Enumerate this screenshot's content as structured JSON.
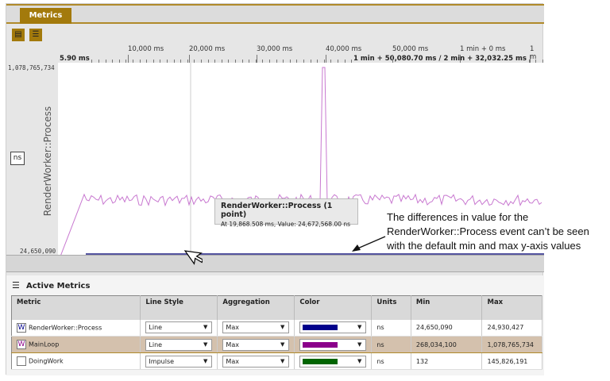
{
  "tab": {
    "label": "Metrics"
  },
  "toolbar": {
    "icons": [
      "clipboard-icon",
      "list-icon"
    ]
  },
  "ruler": {
    "ticks": [
      "10,000 ms",
      "20,000 ms",
      "30,000 ms",
      "40,000 ms",
      "50,000 ms",
      "1 min + 0 ms",
      "1 m"
    ],
    "start": "5.90 ms",
    "range": "1 min + 50,080.70 ms / 2 min + 32,032.25 ms"
  },
  "yaxis": {
    "max": "1,078,765,734",
    "min": "24,650,090",
    "title": "RenderWorker::Process",
    "unit": "ns"
  },
  "tooltip": {
    "title": "RenderWorker::Process (1 point)",
    "body": "At 19,868.508 ms, Value: 24,672,568.00 ns"
  },
  "annotation": "The differences in value for the RenderWorker::Process event can’t be seen with the default min and max y-axis values",
  "active_metrics": {
    "title": "Active Metrics",
    "columns": [
      "Metric",
      "Line Style",
      "Aggregation",
      "Color",
      "Units",
      "Min",
      "Max"
    ],
    "rows": [
      {
        "metric": "RenderWorker::Process",
        "line_style": "Line",
        "aggregation": "Max",
        "color": "#00008b",
        "units": "ns",
        "min": "24,650,090",
        "max": "24,930,427",
        "checked": true,
        "selected": false
      },
      {
        "metric": "MainLoop",
        "line_style": "Line",
        "aggregation": "Max",
        "color": "#8b008b",
        "units": "ns",
        "min": "268,034,100",
        "max": "1,078,765,734",
        "checked": true,
        "selected": true
      },
      {
        "metric": "DoingWork",
        "line_style": "Impulse",
        "aggregation": "Max",
        "color": "#006400",
        "units": "ns",
        "min": "132",
        "max": "145,826,191",
        "checked": false,
        "selected": false
      }
    ]
  },
  "colors": {
    "accent": "#a37a0c",
    "mainloop_line": "#c878d0",
    "renderworker_line": "#5555a0"
  }
}
